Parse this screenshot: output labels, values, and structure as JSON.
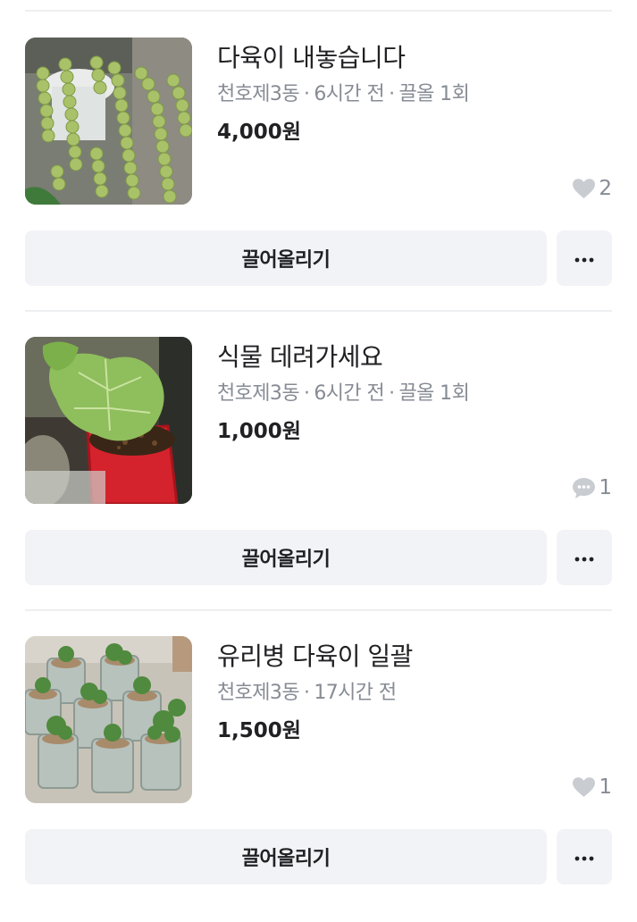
{
  "colors": {
    "background": "#ffffff",
    "button_bg": "#f2f3f6",
    "divider": "#eeeff1",
    "title_text": "#212124",
    "meta_text": "#868b94",
    "icon_gray": "#c9ccd1"
  },
  "items": [
    {
      "title": "다육이 내놓습니다",
      "location": "천호제3동",
      "time": "6시간 전",
      "bump": "끌올 1회",
      "price": "4,000원",
      "count_icon": "heart-icon",
      "count": "2",
      "bump_button": "끌어올리기",
      "more_icon": "more-dots-icon",
      "image": "hanging succulent plant"
    },
    {
      "title": "식물 데려가세요",
      "location": "천호제3동",
      "time": "6시간 전",
      "bump": "끌올 1회",
      "price": "1,000원",
      "count_icon": "chat-bubble-icon",
      "count": "1",
      "bump_button": "끌어올리기",
      "more_icon": "more-dots-icon",
      "image": "leafy plant in red pot"
    },
    {
      "title": "유리병 다육이 일괄",
      "location": "천호제3동",
      "time": "17시간 전",
      "bump": "",
      "price": "1,500원",
      "count_icon": "heart-icon",
      "count": "1",
      "bump_button": "끌어올리기",
      "more_icon": "more-dots-icon",
      "image": "succulents in glass jars"
    }
  ]
}
